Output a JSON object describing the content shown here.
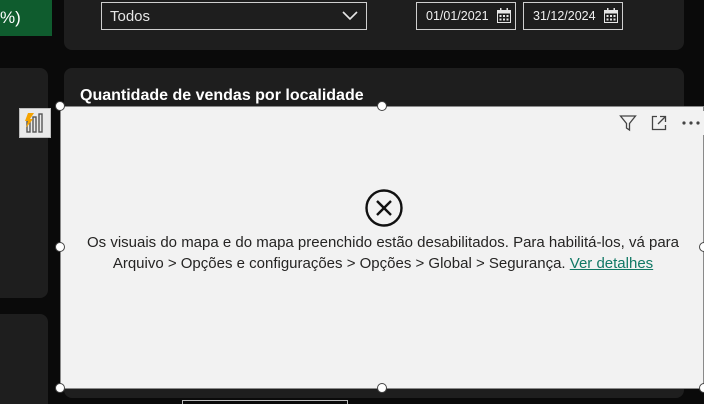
{
  "kpi": {
    "percent_fragment": "%)"
  },
  "filters": {
    "dropdown_value": "Todos",
    "start_date": "01/01/2021",
    "end_date": "31/12/2024"
  },
  "visual": {
    "title": "Quantidade de vendas por localidade",
    "error_message": "Os visuais do mapa e do mapa preenchido estão desabilitados. Para habilitá-los, vá para Arquivo > Opções e configurações > Opções > Global > Segurança.",
    "error_link": "Ver detalhes",
    "header_icons": [
      "filter-icon",
      "focus-mode-icon",
      "more-options-icon"
    ]
  },
  "colors": {
    "page_bg": "#0a0a0a",
    "panel_bg": "#1e1e1e",
    "kpi_green": "#0f5c2e",
    "visual_bg": "#f2f2f2",
    "link": "#117865"
  }
}
